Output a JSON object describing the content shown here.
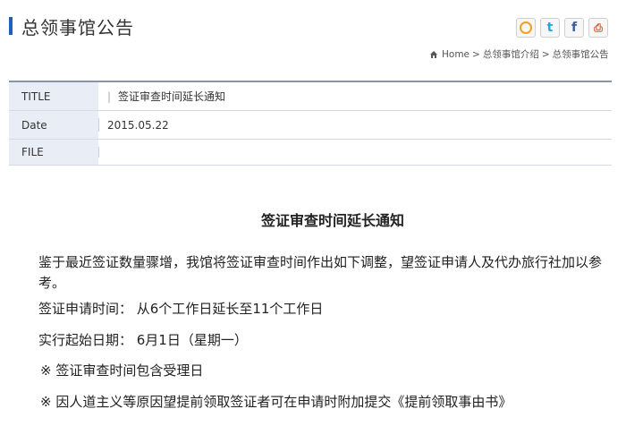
{
  "header": {
    "title": "总领事馆公告",
    "social": [
      "qq-icon",
      "twitter-icon",
      "facebook-icon",
      "print-icon"
    ]
  },
  "breadcrumb": [
    "Home",
    "总领事馆介绍",
    "总领事馆公告"
  ],
  "info": {
    "title_label": "TITLE",
    "title_value": "签证审查时间延长通知",
    "date_label": "Date",
    "date_value": "2015.05.22",
    "file_label": "FILE",
    "file_value": ""
  },
  "article": {
    "heading": "签证审查时间延长通知",
    "para1": "鉴于最近签证数量骤增，我馆将签证审查时间作出如下调整，望签证申请人及代办旅行社加以参考。",
    "para2": "签证申请时间：  从6个工作日延长至11个工作日",
    "para3": "实行起始日期：   6月1日（星期一）",
    "note1": "※ 签证审查时间包含受理日",
    "note2": "※ 因人道主义等原因望提前领取签证者可在申请时附加提交《提前领取事由书》"
  },
  "colors": {
    "accent": "#1f5fbf",
    "label_bg": "#e9eef6",
    "border": "#8a94a8"
  }
}
